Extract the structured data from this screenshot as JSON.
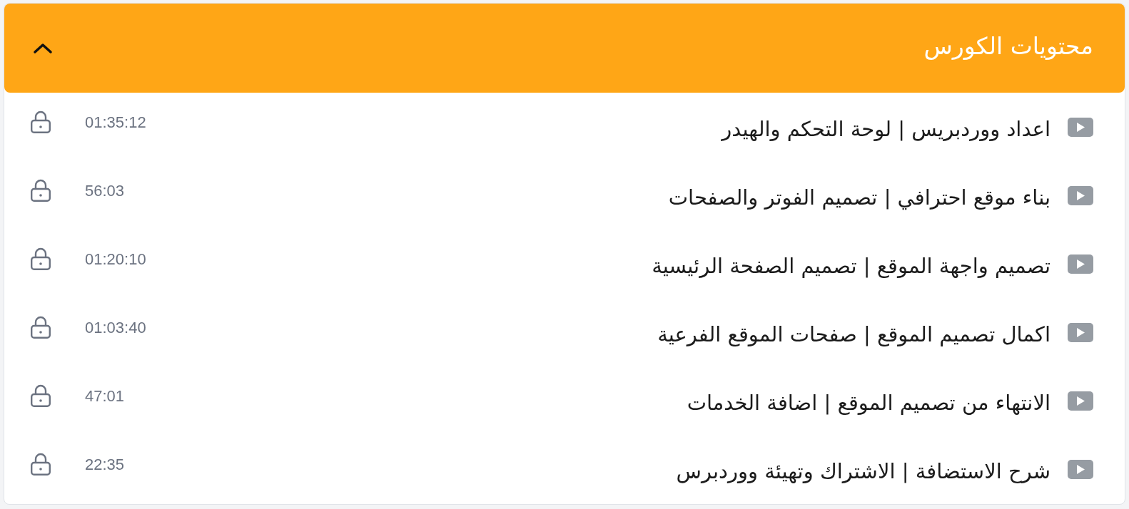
{
  "course_contents": {
    "title": "محتويات الكورس",
    "expanded": true
  },
  "lessons": [
    {
      "title": "اعداد ووردبريس | لوحة التحكم والهيدر",
      "duration": "01:35:12",
      "locked": true
    },
    {
      "title": "بناء موقع احترافي | تصميم الفوتر والصفحات",
      "duration": "56:03",
      "locked": true
    },
    {
      "title": "تصميم واجهة الموقع | تصميم الصفحة الرئيسية",
      "duration": "01:20:10",
      "locked": true
    },
    {
      "title": "اكمال تصميم الموقع | صفحات الموقع الفرعية",
      "duration": "01:03:40",
      "locked": true
    },
    {
      "title": "الانتهاء من تصميم الموقع | اضافة الخدمات",
      "duration": "47:01",
      "locked": true
    },
    {
      "title": "شرح الاستضافة | الاشتراك وتهيئة ووردبرس",
      "duration": "22:35",
      "locked": true
    }
  ]
}
